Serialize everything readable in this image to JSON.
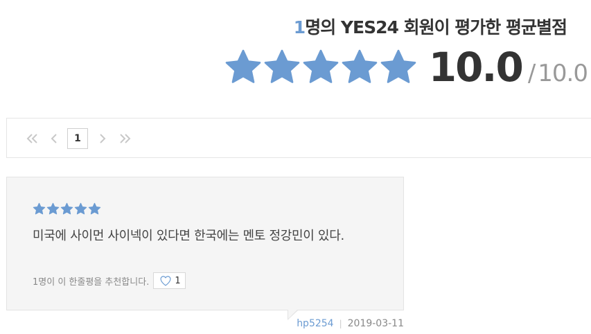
{
  "summary": {
    "count": "1",
    "title_suffix": "명의 YES24 회원이 평가한 평균별점",
    "stars": 5,
    "score": "10.0",
    "max": "10.0",
    "slash": "/"
  },
  "pagination": {
    "first_icon": "double-chevron-left-icon",
    "prev_icon": "chevron-left-icon",
    "current": "1",
    "next_icon": "chevron-right-icon",
    "last_icon": "double-chevron-right-icon"
  },
  "review": {
    "stars": 5,
    "text": "미국에 사이먼 사이넥이 있다면 한국에는 멘토 정강민이 있다.",
    "recommend_text": "1명이 이 한줄평을 추천합니다.",
    "like_count": "1",
    "author": "hp5254",
    "date": "2019-03-11"
  },
  "colors": {
    "accent": "#6b9bd2",
    "star": "#6b9bd2",
    "text": "#333333",
    "muted": "#888888"
  }
}
